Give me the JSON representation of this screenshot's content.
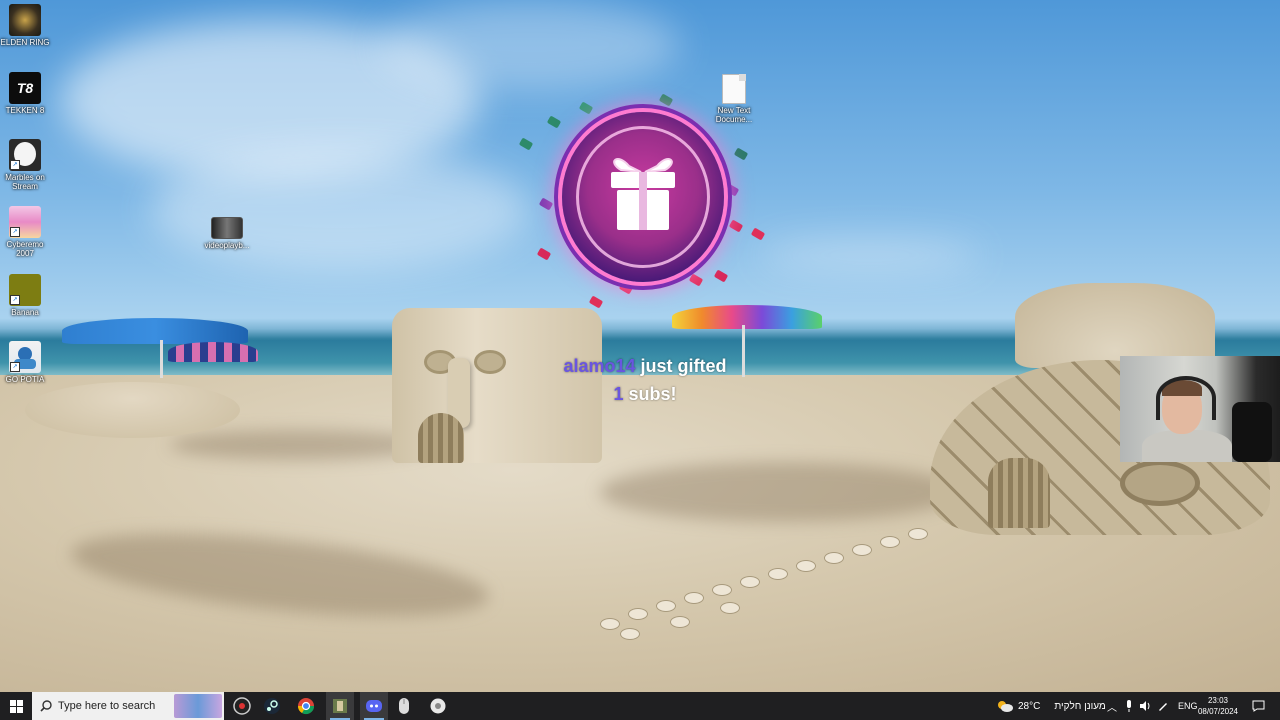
{
  "desktop": {
    "icons": [
      {
        "label": "ELDEN RING"
      },
      {
        "label": "TEKKEN 8"
      },
      {
        "label": "Marbles on Stream"
      },
      {
        "label": "Cyberemo 2007"
      },
      {
        "label": "Banana"
      },
      {
        "label": "GO POTIA"
      },
      {
        "label": "videoplayb..."
      },
      {
        "label": "New Text Docume..."
      }
    ],
    "tekken_logo": "T8"
  },
  "alert": {
    "username": "alamo14",
    "text_after_name": " just gifted",
    "count": "1",
    "text_after_count": " subs!"
  },
  "taskbar": {
    "search_placeholder": "Type here to search",
    "weather_temp": "28°C",
    "weather_desc": "מעונן חלקית",
    "language": "ENG",
    "time": "23:03",
    "date": "08/07/2024"
  },
  "colors": {
    "accent": "#6a55e0",
    "taskbar_bg": "#1f1f21",
    "gift_glow": "#ff7bd0"
  }
}
